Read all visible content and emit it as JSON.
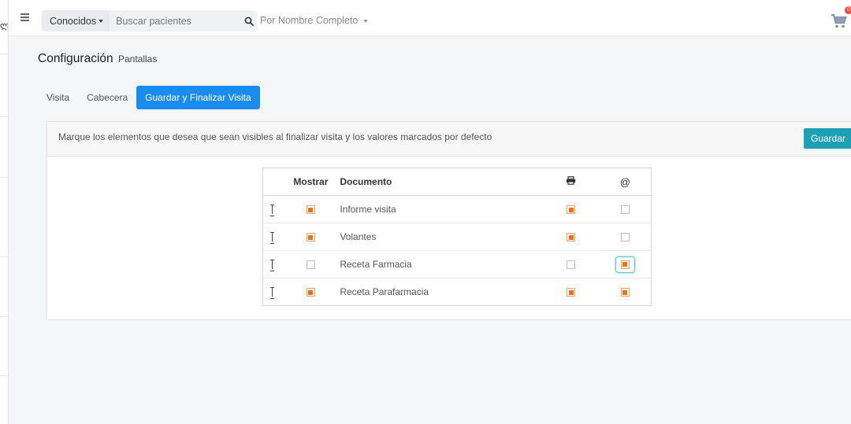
{
  "topbar": {
    "search_mode_label": "Conocidos",
    "search_placeholder": "Buscar pacientes",
    "filter_label": "Por Nombre Completo",
    "cart_badge": "0"
  },
  "page": {
    "title": "Configuración",
    "subtitle": "Pantallas"
  },
  "tabs": [
    {
      "label": "Visita",
      "active": false
    },
    {
      "label": "Cabecera",
      "active": false
    },
    {
      "label": "Guardar y Finalizar Visita",
      "active": true
    }
  ],
  "panel": {
    "message": "Marque los elementos que desea que sean visibles al finalizar visita y los valores marcados por defecto",
    "save_label": "Guardar"
  },
  "table": {
    "headers": {
      "show": "Mostrar",
      "document": "Documento",
      "print_icon": "printer-icon",
      "mail_icon": "@"
    },
    "rows": [
      {
        "document": "Informe visita",
        "show": true,
        "print": true,
        "mail": false
      },
      {
        "document": "Volantes",
        "show": true,
        "print": true,
        "mail": false
      },
      {
        "document": "Receta Farmacia",
        "show": false,
        "print": false,
        "mail": true,
        "mail_focused": true
      },
      {
        "document": "Receta Parafarmacia",
        "show": true,
        "print": true,
        "mail": true
      }
    ]
  },
  "colors": {
    "accent": "#1a8cf0",
    "save_button": "#1ea1b3",
    "checkbox_on": "#e8711c",
    "badge": "#e74c3c"
  }
}
